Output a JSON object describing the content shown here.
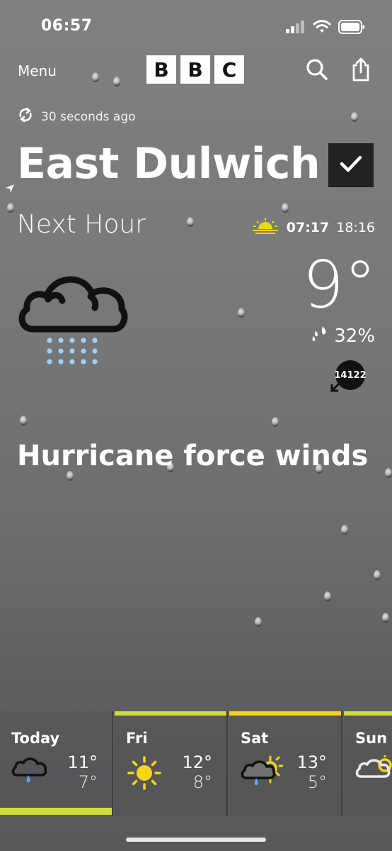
{
  "status": {
    "time": "06:57"
  },
  "header": {
    "menu_label": "Menu",
    "logo_letters": [
      "B",
      "B",
      "C"
    ]
  },
  "updated_text": "30 seconds ago",
  "location": {
    "name": "East Dulwich"
  },
  "next_hour_label": "Next Hour",
  "sun": {
    "sunrise": "07:17",
    "sunset": "18:16"
  },
  "current": {
    "icon": "heavy-rain-cloud-icon",
    "temperature": "9°",
    "precip_chance": "32%",
    "wind_speed": "14122",
    "condition": "Hurricane force winds"
  },
  "forecast": [
    {
      "day": "Today",
      "high": "11°",
      "low": "7°",
      "icon": "light-rain-cloud-icon",
      "selected": true
    },
    {
      "day": "Fri",
      "high": "12°",
      "low": "8°",
      "icon": "sun-icon",
      "selected": false
    },
    {
      "day": "Sat",
      "high": "13°",
      "low": "5°",
      "icon": "sun-cloud-rain-icon",
      "selected": false
    },
    {
      "day": "Sun",
      "high": "",
      "low": "",
      "icon": "sun-cloud-icon",
      "selected": false
    }
  ],
  "colors": {
    "accent": "#cfdc3a",
    "sun": "#f5d419",
    "rain": "#9fd0ff"
  }
}
